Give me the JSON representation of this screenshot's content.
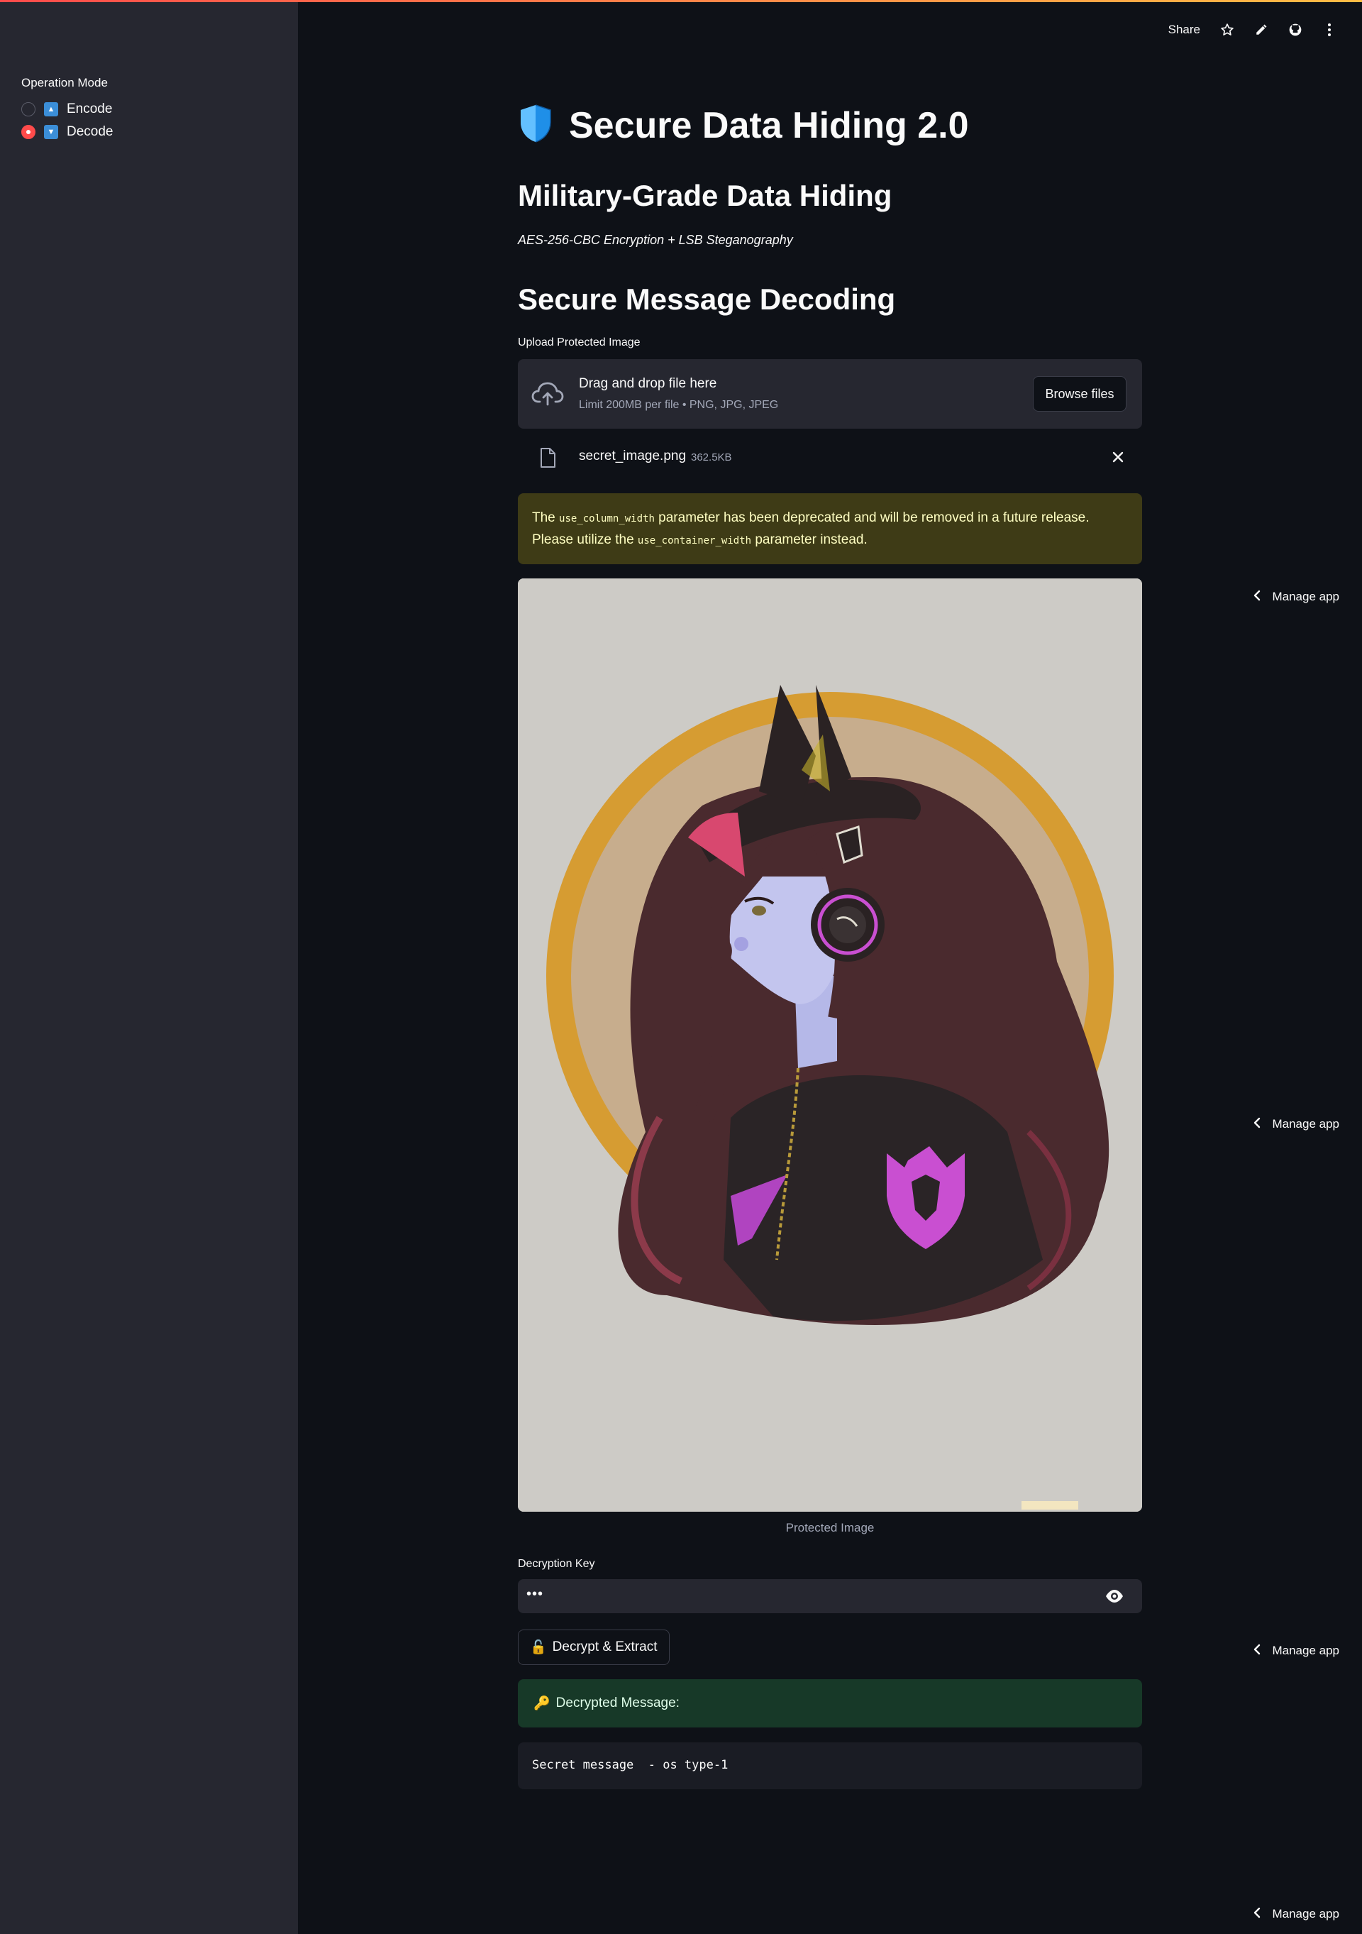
{
  "sidebar": {
    "label": "Operation Mode",
    "options": [
      {
        "label": "Encode",
        "selected": false,
        "icon": "up-arrow-icon"
      },
      {
        "label": "Decode",
        "selected": true,
        "icon": "down-arrow-icon"
      }
    ]
  },
  "toolbar": {
    "share_label": "Share",
    "icons": [
      "star-icon",
      "edit-icon",
      "github-icon",
      "more-vert-icon"
    ]
  },
  "header": {
    "title": "Secure Data Hiding 2.0",
    "title_icon": "shield-icon",
    "subtitle": "Military-Grade Data Hiding",
    "caption": "AES-256-CBC Encryption + LSB Steganography"
  },
  "decode": {
    "section_title": "Secure Message Decoding",
    "upload": {
      "label": "Upload Protected Image",
      "drop_text": "Drag and drop file here",
      "limit_text": "Limit 200MB per file • PNG, JPG, JPEG",
      "browse_label": "Browse files"
    },
    "file": {
      "name": "secret_image.png",
      "size": "362.5KB"
    },
    "warning": {
      "prefix": "The ",
      "code1": "use_column_width",
      "middle": " parameter has been deprecated and will be removed in a future release. Please utilize the ",
      "code2": "use_container_width",
      "suffix": " parameter instead."
    },
    "image_caption": "Protected Image",
    "key": {
      "label": "Decryption Key",
      "value": "•••"
    },
    "decrypt_button": {
      "emoji": "🔓",
      "label": "Decrypt & Extract"
    },
    "result": {
      "emoji": "🔑",
      "label": "Decrypted Message:",
      "message": "Secret message  - os type-1"
    }
  },
  "manage_app": {
    "label": "Manage app"
  },
  "colors": {
    "background": "#0e1117",
    "sidebar": "#262730",
    "accent": "#ff4b4b",
    "warning_bg": "#3e3b16",
    "success_bg": "#173928"
  }
}
